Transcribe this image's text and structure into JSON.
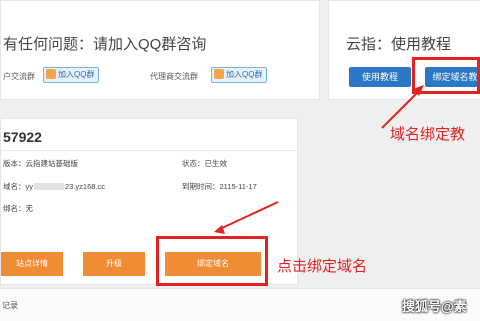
{
  "consult": {
    "title": "有任何问题：请加入QQ群咨询",
    "group1_label": "户交流群",
    "group2_label": "代理商交流群",
    "qq_button_label": "加入QQ群"
  },
  "guide": {
    "title": "云指：使用教程",
    "tutorial_button": "使用教程",
    "bind_button": "绑定域名教"
  },
  "site": {
    "id": "57922",
    "version_label": "版本：",
    "version_value": "云指建站基础版",
    "status_label": "状态：",
    "status_value": "已生效",
    "domain_label": "域名：",
    "domain_value": "yy",
    "domain_suffix": "23.yz168.cc",
    "expire_label": "到期时间：",
    "expire_value": "2115-11-17",
    "bound_label": "绑名：",
    "bound_value": "无"
  },
  "actions": {
    "details": "站点详情",
    "upgrade": "升级",
    "bind_domain": "绑定域名"
  },
  "footer": {
    "records": "记录"
  },
  "annotations": {
    "top": "域名绑定教",
    "bottom": "点击绑定域名"
  },
  "watermark": "搜狐号@素",
  "colors": {
    "accent_blue": "#2b78c4",
    "accent_orange": "#f08c34",
    "annotation_red": "#e32222"
  }
}
